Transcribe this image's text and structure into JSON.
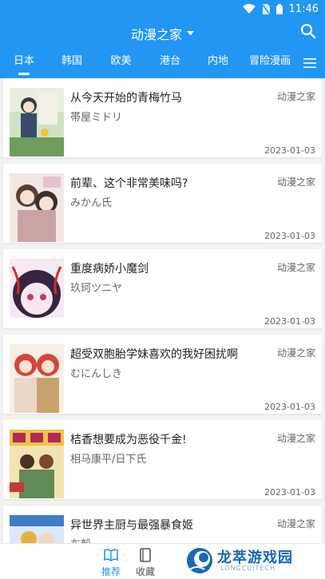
{
  "status_bar": {
    "time": "11:46"
  },
  "app_bar": {
    "title": "动漫之家"
  },
  "tabs": [
    {
      "label": "日本",
      "active": true
    },
    {
      "label": "韩国",
      "active": false
    },
    {
      "label": "欧美",
      "active": false
    },
    {
      "label": "港台",
      "active": false
    },
    {
      "label": "内地",
      "active": false
    },
    {
      "label": "冒险漫画",
      "active": false
    }
  ],
  "items": [
    {
      "title": "从今天开始的青梅竹马",
      "author": "帯屋ミドリ",
      "source": "动漫之家",
      "date": "2023-01-03"
    },
    {
      "title": "前辈、这个非常美味吗?",
      "author": "みかん氏",
      "source": "动漫之家",
      "date": "2023-01-03"
    },
    {
      "title": "重度病娇小魔剑",
      "author": "玖珂ツニヤ",
      "source": "动漫之家",
      "date": "2023-01-03"
    },
    {
      "title": "超受双胞胎学妹喜欢的我好困扰啊",
      "author": "むにんしき",
      "source": "动漫之家",
      "date": "2023-01-03"
    },
    {
      "title": "桔香想要成为恶役千金!",
      "author": "相马康平/日下氏",
      "source": "动漫之家",
      "date": "2023-01-03"
    },
    {
      "title": "异世界主厨与最强暴食姬",
      "author": "东毅",
      "source": "动漫之家",
      "date": ""
    }
  ],
  "bottom_nav": [
    {
      "label": "推荐",
      "active": true
    },
    {
      "label": "收藏",
      "active": false
    }
  ],
  "watermark": {
    "text": "龙萃游戏园",
    "sub": "LONGCUITECH"
  },
  "colors": {
    "primary": "#2196f3",
    "watermark": "#1a67b8"
  }
}
